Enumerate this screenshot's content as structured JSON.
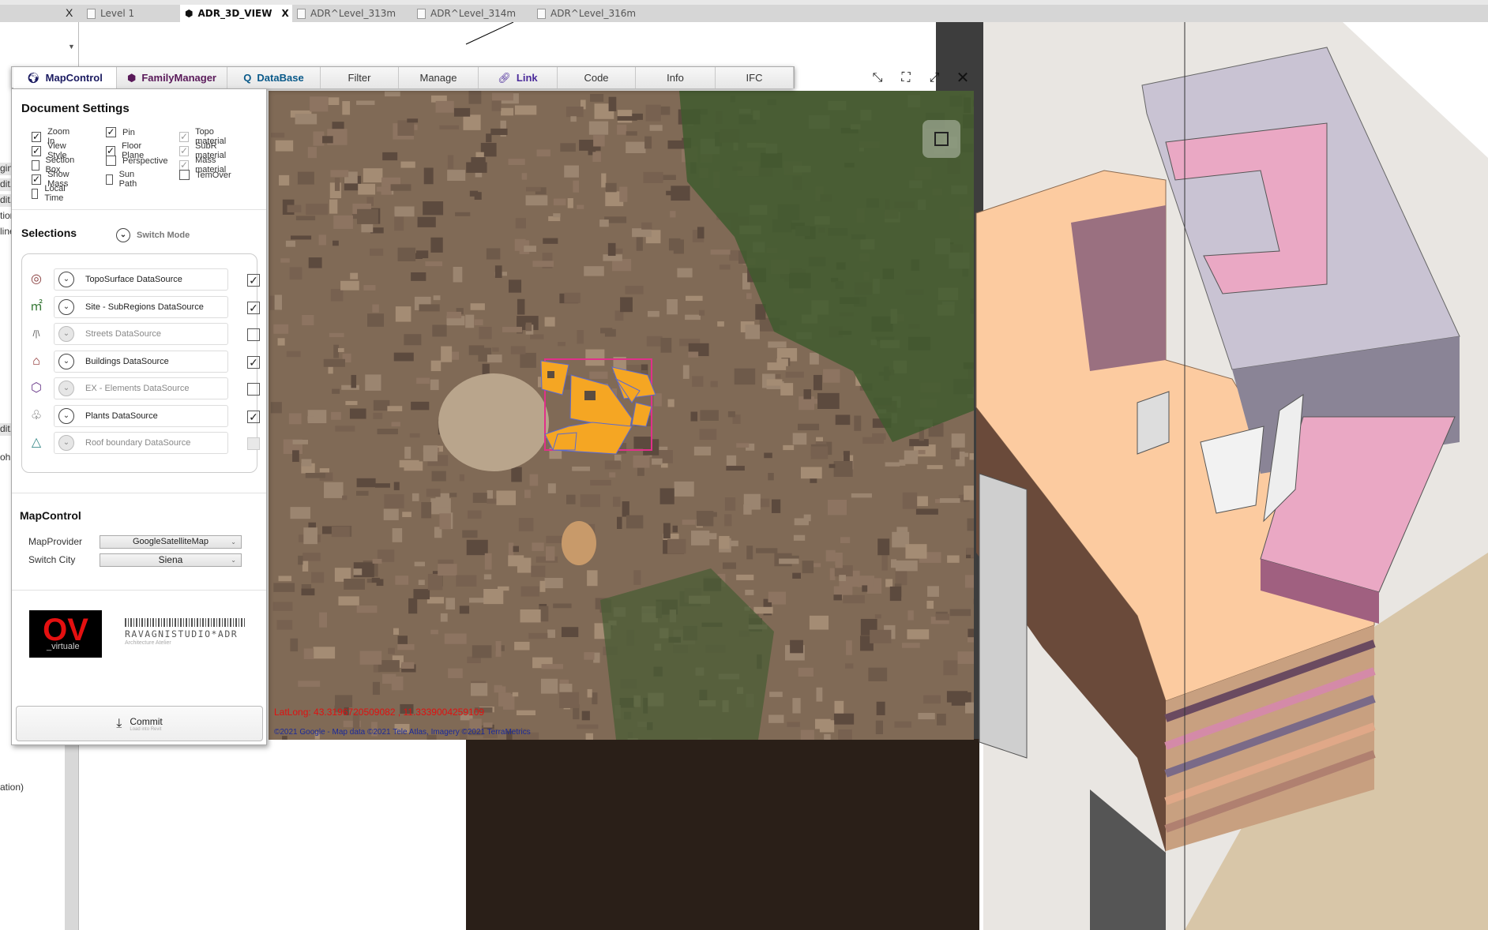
{
  "doc_tabs": {
    "close_left": "X",
    "items": [
      {
        "label": "Level 1",
        "active": false
      },
      {
        "label": "ADR_3D_VIEW",
        "active": true,
        "close": "X"
      },
      {
        "label": "ADR^Level_313m",
        "active": false
      },
      {
        "label": "ADR^Level_314m",
        "active": false
      },
      {
        "label": "ADR^Level_316m",
        "active": false
      }
    ]
  },
  "left_panel": {
    "fragments": [
      "gin",
      "dit.",
      "dit.",
      "tior",
      "line",
      "dit.",
      "ohi",
      "ation)"
    ]
  },
  "plugin_tabs": [
    {
      "label": "MapControl",
      "icon": "globe-icon",
      "color": "#1a1a60"
    },
    {
      "label": "FamilyManager",
      "icon": "cube-icon",
      "color": "#5a1a5a"
    },
    {
      "label": "DataBase",
      "icon": "search-icon",
      "color": "#0a5a8a"
    },
    {
      "label": "Filter"
    },
    {
      "label": "Manage"
    },
    {
      "label": "Link",
      "icon": "link-icon",
      "color": "#4a2a9a"
    },
    {
      "label": "Code"
    },
    {
      "label": "Info"
    },
    {
      "label": "IFC"
    }
  ],
  "document_settings": {
    "title": "Document Settings",
    "options": [
      [
        {
          "label": "Zoom In",
          "checked": true
        },
        {
          "label": "View Style",
          "checked": true
        },
        {
          "label": "Section Box",
          "checked": false
        },
        {
          "label": "Show Mass",
          "checked": true
        },
        {
          "label": "Local Time",
          "checked": false
        }
      ],
      [
        {
          "label": "Pin",
          "checked": true
        },
        {
          "label": "Floor Plane",
          "checked": true
        },
        {
          "label": "Perspective",
          "checked": false
        },
        {
          "label": "Sun Path",
          "checked": false
        }
      ],
      [
        {
          "label": "Topo material",
          "checked": true,
          "disabled": true
        },
        {
          "label": "SubR material",
          "checked": true,
          "disabled": true
        },
        {
          "label": "Mass material",
          "checked": true,
          "disabled": true
        },
        {
          "label": "TemOver",
          "checked": false
        }
      ]
    ]
  },
  "selections": {
    "title": "Selections",
    "switch_mode": "Switch Mode",
    "items": [
      {
        "label": "TopoSurface DataSource",
        "icon": "topo-icon",
        "checked": true,
        "enabled": true
      },
      {
        "label": "Site - SubRegions DataSource",
        "icon": "area-m2-icon",
        "checked": true,
        "enabled": true
      },
      {
        "label": "Streets DataSource",
        "icon": "road-icon",
        "checked": false,
        "enabled": false
      },
      {
        "label": "Buildings DataSource",
        "icon": "house-icon",
        "checked": true,
        "enabled": true
      },
      {
        "label": "EX - Elements DataSource",
        "icon": "box-icon",
        "checked": false,
        "enabled": false
      },
      {
        "label": "Plants DataSource",
        "icon": "tree-icon",
        "checked": true,
        "enabled": true
      },
      {
        "label": "Roof boundary DataSource",
        "icon": "roof-triangle-icon",
        "checked": false,
        "enabled": false
      }
    ]
  },
  "map_control": {
    "title": "MapControl",
    "provider_label": "MapProvider",
    "provider_value": "GoogleSatelliteMap",
    "city_label": "Switch City",
    "city_value": "Siena"
  },
  "branding": {
    "logo_text": "OV _virtuale",
    "studio": "RAVAGNISTUDIO*ADR",
    "studio_sub": "Architecture Atelier"
  },
  "commit": {
    "label": "Commit",
    "sub": "Load into Revit"
  },
  "map": {
    "latlong": "LatLong: 43.3196720509082 , 11.3339004259109",
    "copyright": "©2021 Google - Map data ©2021 Tele Atlas, Imagery ©2021 TerraMetrics",
    "footprint_color": "#f5a623",
    "boundary_color": "#e0308a"
  },
  "view_controls": [
    "restore-icon",
    "fit-icon",
    "maximize-icon",
    "close-icon"
  ]
}
